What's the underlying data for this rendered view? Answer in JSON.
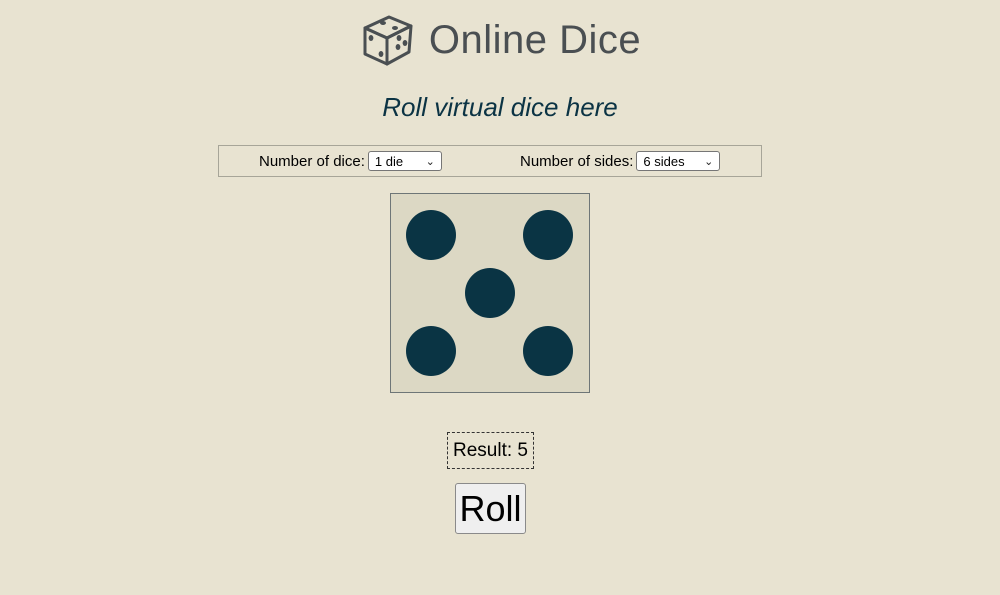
{
  "header": {
    "title": "Online Dice",
    "logo_icon": "dice-icon"
  },
  "subtitle": "Roll virtual dice here",
  "controls": {
    "dice_label": "Number of dice:",
    "dice_selected": "1 die",
    "sides_label": "Number of sides:",
    "sides_selected": "6 sides"
  },
  "die": {
    "face_value": 5
  },
  "result": {
    "text": "Result: 5"
  },
  "roll_button": {
    "label": "Roll"
  },
  "colors": {
    "background": "#e8e3d1",
    "pip": "#0a3444",
    "die_face": "#dcd8c4",
    "title": "#4a4f52",
    "subtitle": "#0b3344"
  }
}
